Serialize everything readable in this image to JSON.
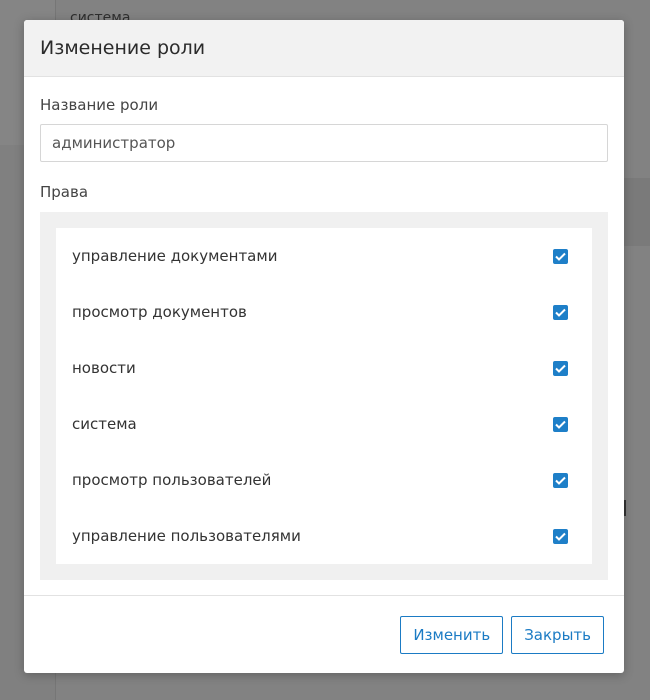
{
  "background": {
    "page_text": "система"
  },
  "modal": {
    "title": "Изменение роли",
    "role_name_label": "Название роли",
    "role_name_value": "администратор",
    "permissions_label": "Права",
    "permissions": [
      {
        "label": "управление документами",
        "checked": true
      },
      {
        "label": "просмотр документов",
        "checked": true
      },
      {
        "label": "новости",
        "checked": true
      },
      {
        "label": "система",
        "checked": true
      },
      {
        "label": "просмотр пользователей",
        "checked": true
      },
      {
        "label": "управление пользователями",
        "checked": true
      }
    ],
    "buttons": {
      "save_label": "Изменить",
      "close_label": "Закрыть"
    }
  },
  "colors": {
    "accent": "#1b7bc4",
    "checkbox_fill": "#1e7fc8",
    "header_bg": "#f2f2f2",
    "overlay": "#808080"
  },
  "icons": {
    "checkbox": "check-icon"
  }
}
